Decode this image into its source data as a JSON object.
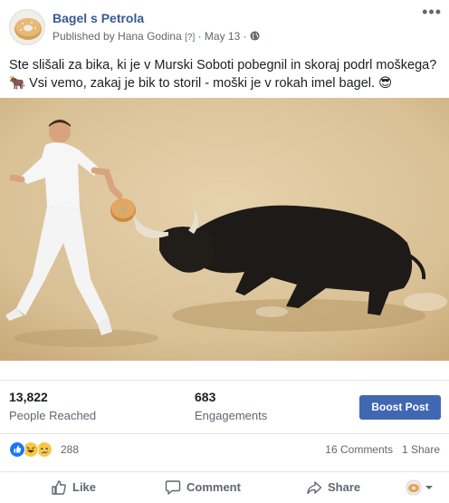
{
  "post": {
    "page_name": "Bagel s Petrola",
    "published_by": "Published by Hana Godina",
    "help_mark": "[?]",
    "separator": "·",
    "date": "May 13",
    "separator2": "·",
    "text_line1": "Ste slišali za bika, ki je v Murski Soboti pobegnil in skoraj podrl moškega?",
    "text_line2": "🐂 Vsi vemo, zakaj je bik to storil - moški je v rokah imel bagel. 😎"
  },
  "insights": {
    "reached_value": "13,822",
    "reached_label": "People Reached",
    "engagements_value": "683",
    "engagements_label": "Engagements",
    "boost_label": "Boost Post"
  },
  "reactions": {
    "count": "288",
    "comments": "16 Comments",
    "shares": "1 Share",
    "types": [
      "like-icon",
      "haha-icon",
      "sad-icon"
    ]
  },
  "actions": {
    "like": "Like",
    "comment": "Comment",
    "share": "Share"
  },
  "colors": {
    "link": "#385898",
    "brand": "#4267b2",
    "secondary_text": "#606770"
  }
}
